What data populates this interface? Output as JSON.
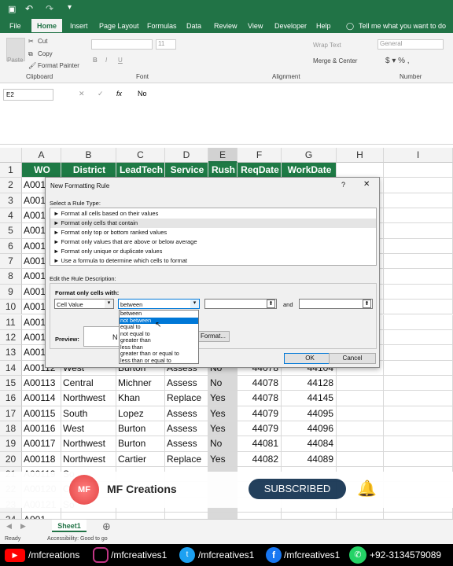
{
  "titlebar": {
    "icons": [
      "save-icon",
      "undo-icon",
      "redo-icon",
      "customize-icon"
    ]
  },
  "tabs": [
    "File",
    "Home",
    "Insert",
    "Page Layout",
    "Formulas",
    "Data",
    "Review",
    "View",
    "Developer",
    "Help"
  ],
  "tell_me": "Tell me what you want to do",
  "ribbon": {
    "cut": "Cut",
    "copy": "Copy",
    "paste": "Paste",
    "format_painter": "Format Painter",
    "clipboard": "Clipboard",
    "font": "Font",
    "font_size": "11",
    "wrap": "Wrap Text",
    "merge": "Merge & Center",
    "alignment": "Alignment",
    "number_format": "General",
    "number": "Number"
  },
  "formula": {
    "namebox": "E2",
    "fx": "fx",
    "value": "No"
  },
  "columns": [
    "A",
    "B",
    "C",
    "D",
    "E",
    "F",
    "G",
    "H",
    "I"
  ],
  "headers": [
    "WO",
    "District",
    "LeadTech",
    "Service",
    "Rush",
    "ReqDate",
    "WorkDate"
  ],
  "row_numbers": [
    "1",
    "2",
    "3",
    "4",
    "5",
    "6",
    "7",
    "8",
    "9",
    "10",
    "11",
    "12",
    "13",
    "14",
    "15",
    "16",
    "17",
    "18",
    "19",
    "20",
    "21",
    "22",
    "23",
    "24"
  ],
  "a_partial": [
    "A001",
    "A001",
    "A001",
    "A001",
    "A001",
    "A001",
    "A001",
    "A001",
    "A001",
    "A001",
    "A001",
    "A001"
  ],
  "rows": [
    [
      "A00112",
      "West",
      "Burton",
      "Assess",
      "No",
      "44078",
      "44104"
    ],
    [
      "A00113",
      "Central",
      "Michner",
      "Assess",
      "No",
      "44078",
      "44128"
    ],
    [
      "A00114",
      "Northwest",
      "Khan",
      "Replace",
      "Yes",
      "44078",
      "44145"
    ],
    [
      "A00115",
      "South",
      "Lopez",
      "Assess",
      "Yes",
      "44079",
      "44095"
    ],
    [
      "A00116",
      "West",
      "Burton",
      "Assess",
      "Yes",
      "44079",
      "44096"
    ],
    [
      "A00117",
      "Northwest",
      "Burton",
      "Assess",
      "No",
      "44081",
      "44084"
    ],
    [
      "A00118",
      "Northwest",
      "Cartier",
      "Replace",
      "Yes",
      "44082",
      "44089"
    ]
  ],
  "tail_rows": [
    [
      "A00119",
      "So"
    ],
    [
      "A00120",
      "C"
    ],
    [
      "A00121",
      "So"
    ],
    [
      "A001",
      ""
    ]
  ],
  "dialog": {
    "title": "New Formatting Rule",
    "help": "?",
    "close": "✕",
    "select_label": "Select a Rule Type:",
    "rule_types": [
      "► Format all cells based on their values",
      "► Format only cells that contain",
      "► Format only top or bottom ranked values",
      "► Format only values that are above or below average",
      "► Format only unique or duplicate values",
      "► Use a formula to determine which cells to format"
    ],
    "edit_label": "Edit the Rule Description:",
    "format_only": "Format only cells with:",
    "cell_value": "Cell Value",
    "operator": "between",
    "and": "and",
    "operators": [
      "between",
      "not between",
      "equal to",
      "not equal to",
      "greater than",
      "less than",
      "greater than or equal to",
      "less than or equal to"
    ],
    "preview": "Preview:",
    "preview_text": "N",
    "format_btn": "Format...",
    "ok": "OK",
    "cancel": "Cancel"
  },
  "sheet_tab": "Sheet1",
  "status": {
    "ready": "Ready",
    "accessibility": "Accessibility: Good to go"
  },
  "promo": {
    "brand": "MF Creations",
    "subscribe": "SUBSCRIBED",
    "logo": "MF"
  },
  "social": [
    "/mfcreations",
    "/mfcreatives1",
    "/mfcreatives1",
    "/mfcreatives1",
    "+92-3134579089"
  ],
  "colors": {
    "excel_green": "#217346",
    "header_green": "#1e7a45",
    "youtube": "#ff0000",
    "instagram": "#c13584",
    "twitter": "#1da1f2",
    "facebook": "#1877f2",
    "whatsapp": "#25d366"
  }
}
